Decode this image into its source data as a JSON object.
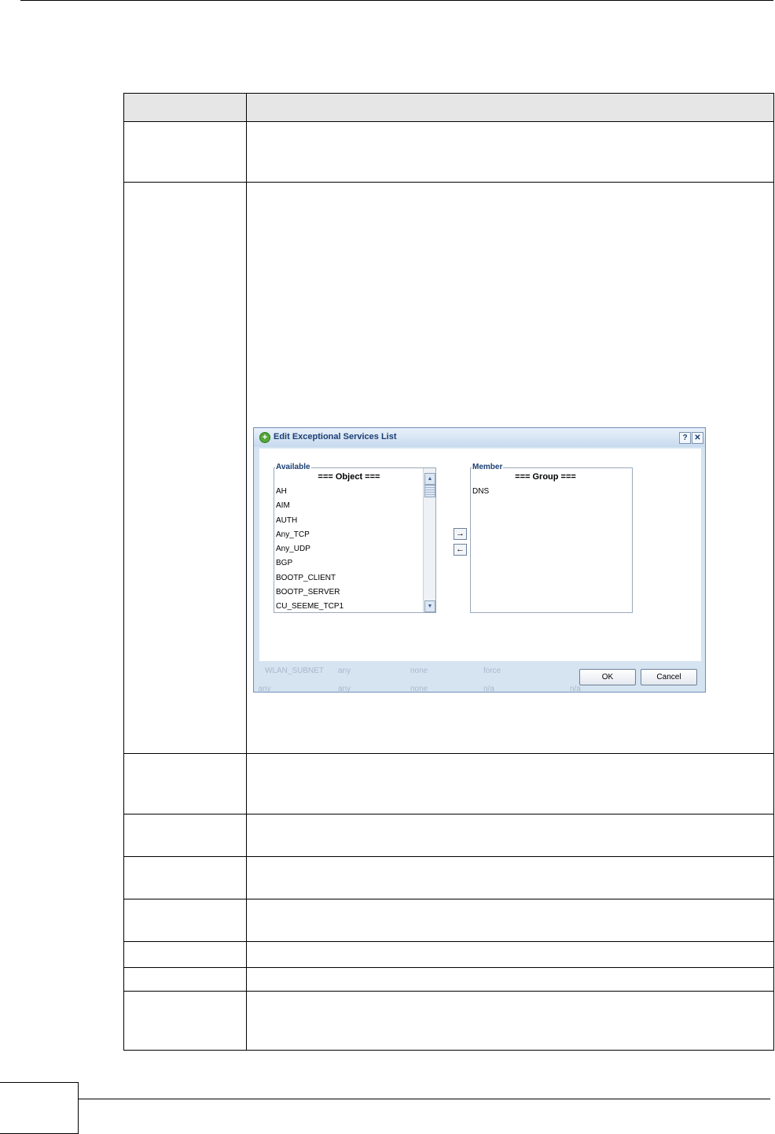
{
  "dialog": {
    "title": "Edit Exceptional Services List",
    "help_label": "?",
    "close_label": "✕",
    "available": {
      "legend": "Available",
      "caption": "=== Object ===",
      "items": [
        "AH",
        "AIM",
        "AUTH",
        "Any_TCP",
        "Any_UDP",
        "BGP",
        "BOOTP_CLIENT",
        "BOOTP_SERVER",
        "CU_SEEME_TCP1"
      ]
    },
    "member": {
      "legend": "Member",
      "caption": "=== Group ===",
      "items": [
        "DNS"
      ]
    },
    "add_arrow": "→",
    "remove_arrow": "←",
    "ok_label": "OK",
    "cancel_label": "Cancel",
    "background_rows": [
      [
        "WLAN_SUBNET",
        "any",
        "none",
        "force"
      ],
      [
        "_any",
        "any",
        "none",
        "n/a",
        "n/a"
      ]
    ]
  },
  "icons": {
    "title_icon": "add-circle-icon",
    "scroll_up": "chevron-up-icon",
    "scroll_down": "chevron-down-icon"
  }
}
